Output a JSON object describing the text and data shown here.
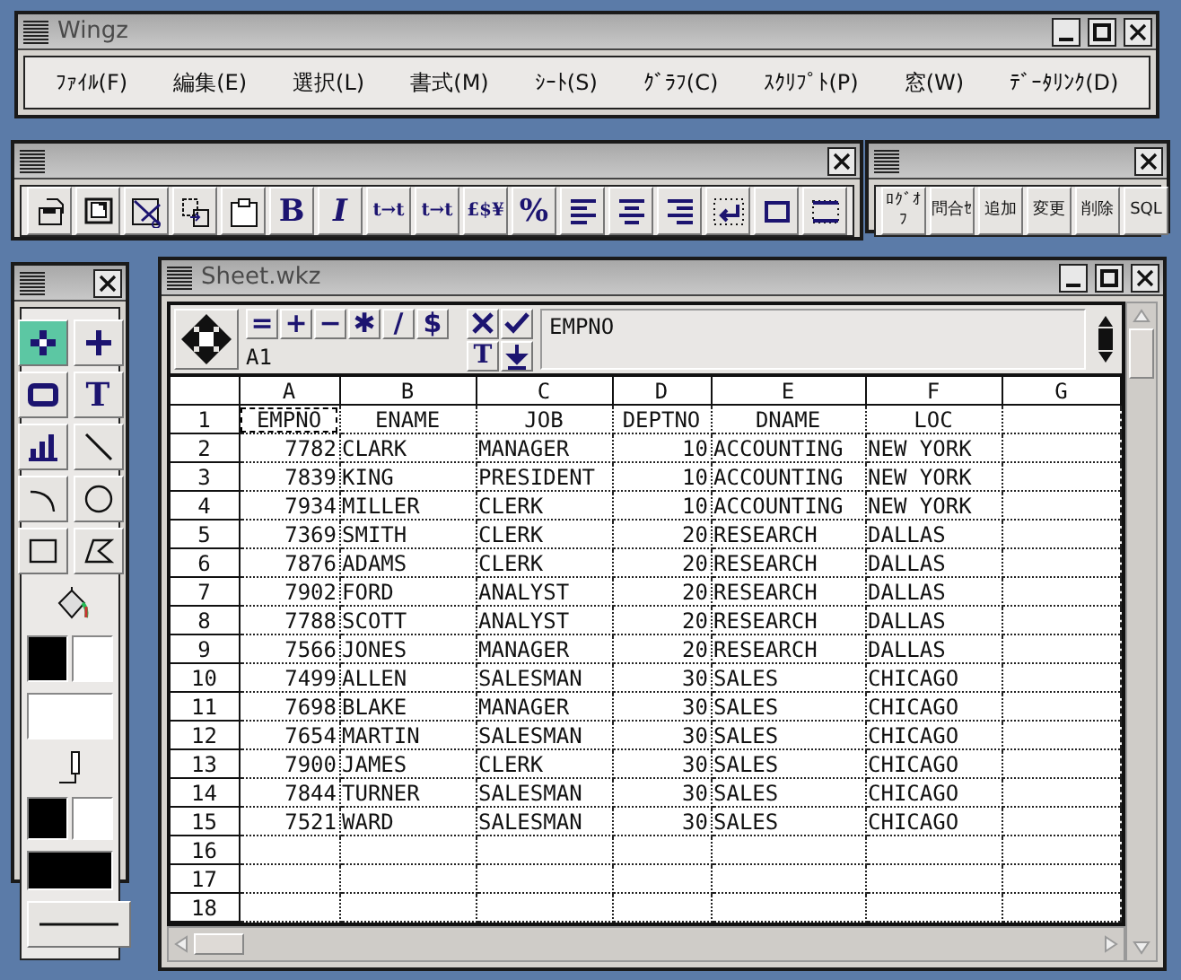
{
  "main_window": {
    "title": "Wingz",
    "menu": [
      "ﾌｧｲﾙ(F)",
      "編集(E)",
      "選択(L)",
      "書式(M)",
      "ｼｰﾄ(S)",
      "ｸﾞﾗﾌ(C)",
      "ｽｸﾘﾌﾟﾄ(P)",
      "窓(W)",
      "ﾃﾞｰﾀﾘﾝｸ(D)"
    ]
  },
  "format_toolbar": {
    "buttons": [
      {
        "kind": "icon"
      },
      {
        "kind": "icon"
      },
      {
        "kind": "icon"
      },
      {
        "kind": "icon"
      },
      {
        "kind": "icon"
      },
      {
        "kind": "text",
        "label": "B"
      },
      {
        "kind": "text",
        "label": "I"
      },
      {
        "kind": "text",
        "label": "t→t"
      },
      {
        "kind": "text",
        "label": "t→t"
      },
      {
        "kind": "text",
        "label": "£$¥"
      },
      {
        "kind": "text",
        "label": "%"
      },
      {
        "kind": "icon"
      },
      {
        "kind": "icon"
      },
      {
        "kind": "icon"
      },
      {
        "kind": "icon"
      },
      {
        "kind": "icon"
      },
      {
        "kind": "icon"
      }
    ]
  },
  "database_toolbar": {
    "buttons": [
      "ﾛｸﾞｵﾌ",
      "問合ｾ",
      "追加",
      "変更",
      "削除",
      "SQL"
    ]
  },
  "tools_palette": {
    "tools": [
      {
        "kind": "icon",
        "selected": true
      },
      {
        "kind": "icon",
        "selected": false
      },
      {
        "kind": "icon",
        "selected": false
      },
      {
        "kind": "text",
        "label": "T",
        "selected": false
      },
      {
        "kind": "icon",
        "selected": false
      },
      {
        "kind": "icon",
        "selected": false
      },
      {
        "kind": "icon",
        "selected": false
      },
      {
        "kind": "icon",
        "selected": false
      },
      {
        "kind": "icon",
        "selected": false
      },
      {
        "kind": "icon",
        "selected": false
      }
    ],
    "fill_colors": [
      {
        "color": "#000000"
      },
      {
        "color": "#ffffff"
      }
    ],
    "fill_pattern": {
      "color": "#ffffff"
    },
    "line_colors": [
      {
        "color": "#000000"
      },
      {
        "color": "#ffffff"
      }
    ],
    "line_pattern": {
      "color": "#000000"
    }
  },
  "sheet_window": {
    "title": "Sheet.wkz",
    "operators": [
      "=",
      "+",
      "−",
      "✱",
      "/",
      "$"
    ],
    "edit_buttons": [
      {
        "kind": "icon"
      },
      {
        "kind": "icon"
      },
      {
        "kind": "text",
        "label": "T"
      },
      {
        "kind": "icon"
      }
    ],
    "cell_reference": "A1",
    "cell_contents": "EMPNO",
    "columns": [
      "A",
      "B",
      "C",
      "D",
      "E",
      "F",
      "G"
    ],
    "rows": [
      {
        "number": "1",
        "kind": "header",
        "selected": [
          true,
          false,
          false,
          false,
          false,
          false,
          false
        ],
        "cells": [
          "EMPNO",
          "ENAME",
          "JOB",
          "DEPTNO",
          "DNAME",
          "LOC"
        ]
      },
      {
        "number": "2",
        "kind": "data",
        "cells": [
          "7782",
          "CLARK",
          "MANAGER",
          "10",
          "ACCOUNTING",
          "NEW YORK"
        ]
      },
      {
        "number": "3",
        "kind": "data",
        "cells": [
          "7839",
          "KING",
          "PRESIDENT",
          "10",
          "ACCOUNTING",
          "NEW YORK"
        ]
      },
      {
        "number": "4",
        "kind": "data",
        "cells": [
          "7934",
          "MILLER",
          "CLERK",
          "10",
          "ACCOUNTING",
          "NEW YORK"
        ]
      },
      {
        "number": "5",
        "kind": "data",
        "cells": [
          "7369",
          "SMITH",
          "CLERK",
          "20",
          "RESEARCH",
          "DALLAS"
        ]
      },
      {
        "number": "6",
        "kind": "data",
        "cells": [
          "7876",
          "ADAMS",
          "CLERK",
          "20",
          "RESEARCH",
          "DALLAS"
        ]
      },
      {
        "number": "7",
        "kind": "data",
        "cells": [
          "7902",
          "FORD",
          "ANALYST",
          "20",
          "RESEARCH",
          "DALLAS"
        ]
      },
      {
        "number": "8",
        "kind": "data",
        "cells": [
          "7788",
          "SCOTT",
          "ANALYST",
          "20",
          "RESEARCH",
          "DALLAS"
        ]
      },
      {
        "number": "9",
        "kind": "data",
        "cells": [
          "7566",
          "JONES",
          "MANAGER",
          "20",
          "RESEARCH",
          "DALLAS"
        ]
      },
      {
        "number": "10",
        "kind": "data",
        "cells": [
          "7499",
          "ALLEN",
          "SALESMAN",
          "30",
          "SALES",
          "CHICAGO"
        ]
      },
      {
        "number": "11",
        "kind": "data",
        "cells": [
          "7698",
          "BLAKE",
          "MANAGER",
          "30",
          "SALES",
          "CHICAGO"
        ]
      },
      {
        "number": "12",
        "kind": "data",
        "cells": [
          "7654",
          "MARTIN",
          "SALESMAN",
          "30",
          "SALES",
          "CHICAGO"
        ]
      },
      {
        "number": "13",
        "kind": "data",
        "cells": [
          "7900",
          "JAMES",
          "CLERK",
          "30",
          "SALES",
          "CHICAGO"
        ]
      },
      {
        "number": "14",
        "kind": "data",
        "cells": [
          "7844",
          "TURNER",
          "SALESMAN",
          "30",
          "SALES",
          "CHICAGO"
        ]
      },
      {
        "number": "15",
        "kind": "data",
        "cells": [
          "7521",
          "WARD",
          "SALESMAN",
          "30",
          "SALES",
          "CHICAGO"
        ]
      },
      {
        "number": "16",
        "kind": "data",
        "cells": []
      },
      {
        "number": "17",
        "kind": "data",
        "cells": []
      },
      {
        "number": "18",
        "kind": "data",
        "cells": []
      }
    ]
  }
}
